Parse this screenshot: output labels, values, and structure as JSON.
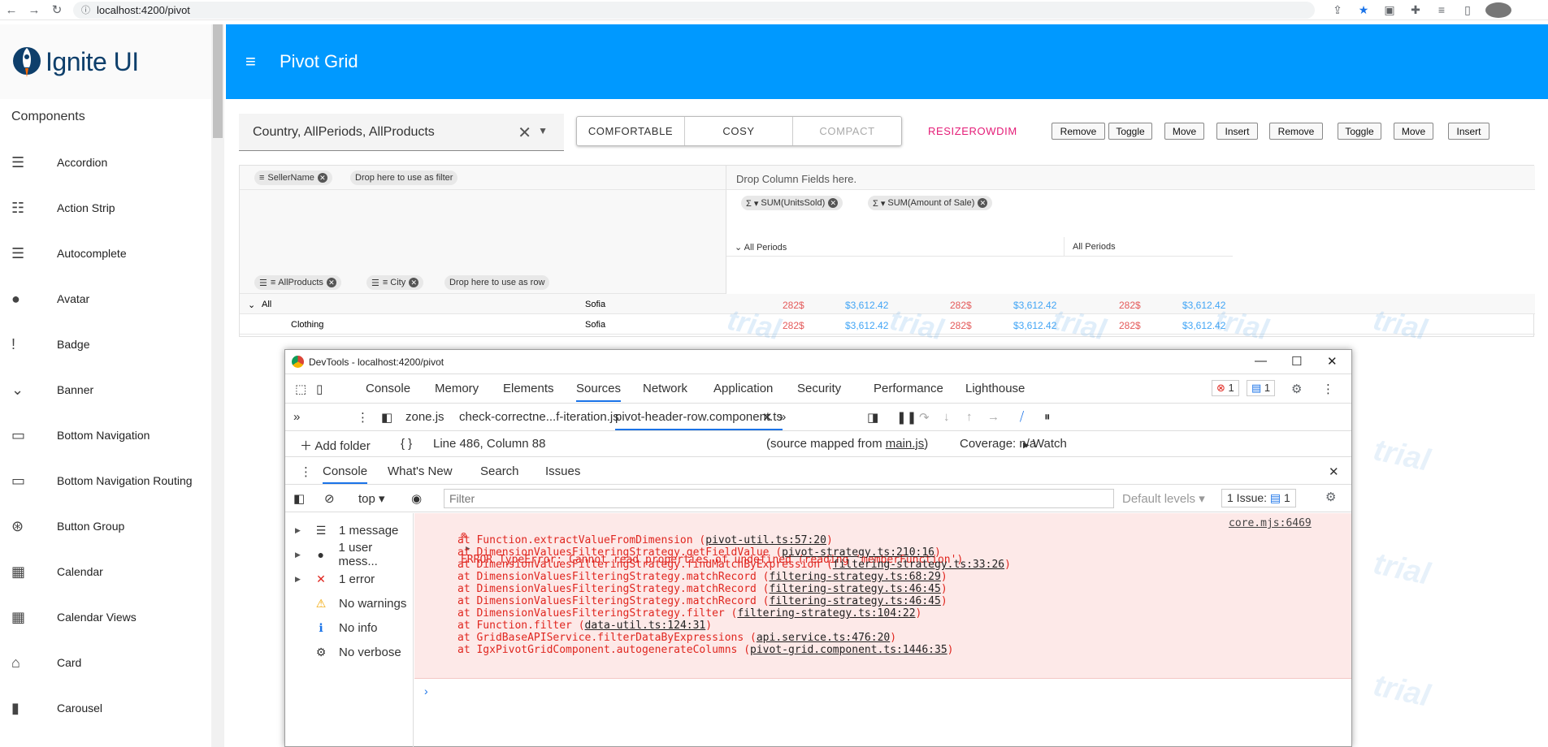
{
  "browser": {
    "url": "localhost:4200/pivot"
  },
  "sidebar": {
    "logo": "Ignite UI",
    "section_title": "Components",
    "items": [
      {
        "label": "Accordion",
        "icon": "accordion-icon",
        "glyph": "☰"
      },
      {
        "label": "Action Strip",
        "icon": "action-strip-icon",
        "glyph": "☷"
      },
      {
        "label": "Autocomplete",
        "icon": "autocomplete-icon",
        "glyph": "☰"
      },
      {
        "label": "Avatar",
        "icon": "avatar-icon",
        "glyph": "●"
      },
      {
        "label": "Badge",
        "icon": "badge-icon",
        "glyph": "!"
      },
      {
        "label": "Banner",
        "icon": "banner-icon",
        "glyph": "⌄"
      },
      {
        "label": "Bottom Navigation",
        "icon": "bottom-nav-icon",
        "glyph": "▭"
      },
      {
        "label": "Bottom Navigation Routing",
        "icon": "bottom-nav-routing-icon",
        "glyph": "▭"
      },
      {
        "label": "Button Group",
        "icon": "button-group-icon",
        "glyph": "⊛"
      },
      {
        "label": "Calendar",
        "icon": "calendar-icon",
        "glyph": "▦"
      },
      {
        "label": "Calendar Views",
        "icon": "calendar-views-icon",
        "glyph": "▦"
      },
      {
        "label": "Card",
        "icon": "card-icon",
        "glyph": "⌂"
      },
      {
        "label": "Carousel",
        "icon": "carousel-icon",
        "glyph": "▮"
      }
    ]
  },
  "header": {
    "title": "Pivot Grid"
  },
  "toolbar": {
    "combo_value": "Country, AllPeriods, AllProducts",
    "density": [
      "COMFORTABLE",
      "COSY",
      "COMPACT"
    ],
    "resize_label": "RESIZEROWDIM",
    "buttons": [
      "Remove",
      "Toggle",
      "Move",
      "Insert",
      "Remove",
      "Toggle",
      "Move",
      "Insert"
    ]
  },
  "pivot": {
    "filter_chip": "SellerName",
    "filter_drop": "Drop here to use as filter",
    "column_drop": "Drop Column Fields here.",
    "value_chips": [
      "SUM(UnitsSold)",
      "SUM(Amount of Sale)"
    ],
    "period_headers": [
      "All Periods",
      "All Periods"
    ],
    "row_chips": [
      "AllProducts",
      "City"
    ],
    "row_drop": "Drop here to use as row",
    "rows": [
      {
        "dim1": "All",
        "dim2": "Sofia",
        "values": [
          "282$",
          "$3,612.42",
          "282$",
          "$3,612.42",
          "282$",
          "$3,612.42"
        ]
      },
      {
        "dim1": "Clothing",
        "dim2": "Sofia",
        "values": [
          "282$",
          "$3,612.42",
          "282$",
          "$3,612.42",
          "282$",
          "$3,612.42"
        ]
      }
    ],
    "watermark": "trial"
  },
  "devtools": {
    "title": "DevTools - localhost:4200/pivot",
    "tabs": [
      "Console",
      "Memory",
      "Elements",
      "Sources",
      "Network",
      "Application",
      "Security",
      "Performance",
      "Lighthouse"
    ],
    "error_count": "1",
    "issue_count": "1",
    "files": [
      "zone.js",
      "check-correctne...f-iteration.js",
      "pivot-header-row.component.ts"
    ],
    "add_folder": "Add folder",
    "position": "Line 486, Column 88",
    "source_mapped": "(source mapped from ",
    "source_file": "main.js",
    "source_close": ")",
    "coverage": "Coverage: n/a",
    "watch": "Watch",
    "drawer_tabs": [
      "Console",
      "What's New",
      "Search",
      "Issues"
    ],
    "context": "top",
    "filter_placeholder": "Filter",
    "levels": "Default levels",
    "issues_label": "1 Issue:",
    "issues_num": "1",
    "side_messages": [
      {
        "label": "1 message",
        "icon": "list-icon",
        "glyph": "☰"
      },
      {
        "label": "1 user mess...",
        "icon": "user-icon",
        "glyph": "●"
      },
      {
        "label": "1 error",
        "icon": "error-icon",
        "glyph": "✕"
      },
      {
        "label": "No warnings",
        "icon": "warning-icon",
        "glyph": "⚠"
      },
      {
        "label": "No info",
        "icon": "info-icon",
        "glyph": "ℹ"
      },
      {
        "label": "No verbose",
        "icon": "verbose-icon",
        "glyph": "⚙"
      }
    ],
    "error_head": "ERROR TypeError: Cannot read properties of undefined (reading 'memberFunction')",
    "error_source": "core.mjs:6469",
    "stack": [
      {
        "fn": "at Function.extractValueFromDimension (",
        "link": "pivot-util.ts:57:20"
      },
      {
        "fn": "at DimensionValuesFilteringStrategy.getFieldValue (",
        "link": "pivot-strategy.ts:210:16"
      },
      {
        "fn": "at DimensionValuesFilteringStrategy.findMatchByExpression (",
        "link": "filtering-strategy.ts:33:26"
      },
      {
        "fn": "at DimensionValuesFilteringStrategy.matchRecord (",
        "link": "filtering-strategy.ts:68:29"
      },
      {
        "fn": "at DimensionValuesFilteringStrategy.matchRecord (",
        "link": "filtering-strategy.ts:46:45"
      },
      {
        "fn": "at DimensionValuesFilteringStrategy.matchRecord (",
        "link": "filtering-strategy.ts:46:45"
      },
      {
        "fn": "at DimensionValuesFilteringStrategy.filter (",
        "link": "filtering-strategy.ts:104:22"
      },
      {
        "fn": "at Function.filter (",
        "link": "data-util.ts:124:31"
      },
      {
        "fn": "at GridBaseAPIService.filterDataByExpressions (",
        "link": "api.service.ts:476:20"
      },
      {
        "fn": "at IgxPivotGridComponent.autogenerateColumns (",
        "link": "pivot-grid.component.ts:1446:35"
      }
    ],
    "close_paren": ")"
  },
  "colors": {
    "header": "#0099ff",
    "accent": "#e41c77",
    "error": "#e0261f",
    "link": "#1a73e8"
  }
}
